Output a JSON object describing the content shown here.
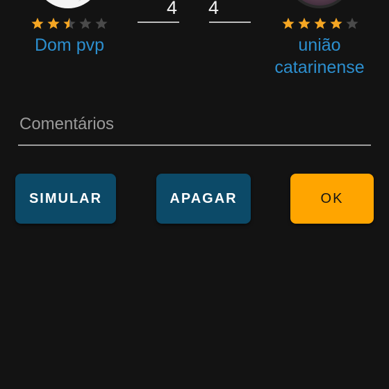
{
  "colors": {
    "background": "#131313",
    "team_name": "#2c8fcf",
    "star_filled": "#f5a623",
    "star_empty": "#4a4a4a",
    "button_primary": "#0c4a68",
    "button_ok": "#ffa500"
  },
  "match": {
    "home": {
      "name": "Dom pvp",
      "rating": 2.5,
      "rating_max": 5,
      "score": "4"
    },
    "away": {
      "name": "união catarinense",
      "rating": 4,
      "rating_max": 5,
      "score": "4"
    }
  },
  "comments": {
    "placeholder": "Comentários",
    "value": ""
  },
  "actions": {
    "simulate_label": "SIMULAR",
    "clear_label": "APAGAR",
    "ok_label": "OK"
  }
}
